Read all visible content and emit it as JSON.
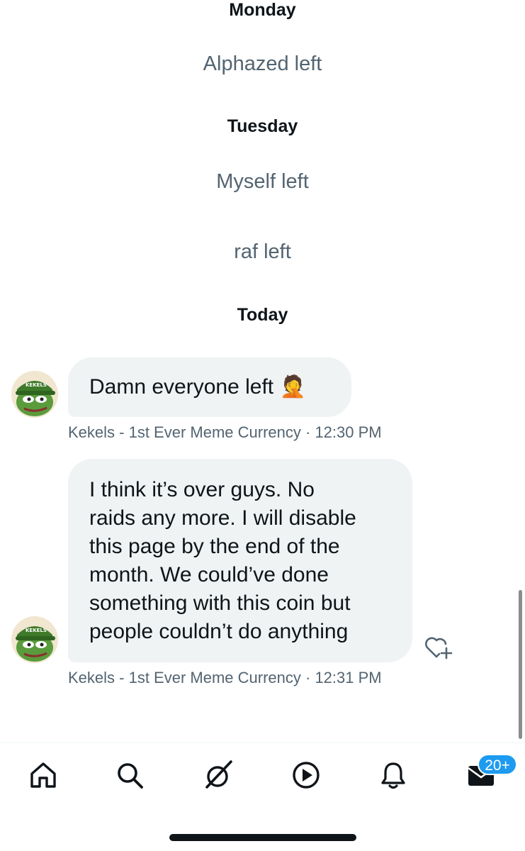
{
  "timeline": [
    {
      "type": "day",
      "label": "Monday"
    },
    {
      "type": "system",
      "text": "Alphazed left"
    },
    {
      "type": "day",
      "label": "Tuesday"
    },
    {
      "type": "system",
      "text": "Myself left"
    },
    {
      "type": "system",
      "text": "raf left"
    },
    {
      "type": "day",
      "label": "Today"
    }
  ],
  "messages": [
    {
      "lines": [
        "Damn everyone left"
      ],
      "emoji": "🤦",
      "sender": "Kekels - 1st Ever Meme Currency",
      "time": "12:30 PM",
      "avatar_text": "KEKELS"
    },
    {
      "lines": [
        "I think it’s over guys. No",
        "raids any more. I will disable",
        "this page by the end of the",
        "month. We could’ve done",
        "something with this coin but",
        "people couldn’t do anything"
      ],
      "sender": "Kekels - 1st Ever Meme Currency",
      "time": "12:31 PM",
      "avatar_text": "KEKELS"
    }
  ],
  "meta_separator": " · ",
  "tabbar": {
    "items": [
      "home-icon",
      "search-icon",
      "grok-icon",
      "video-icon",
      "notifications-icon",
      "messages-icon"
    ],
    "messages_badge": "20+"
  },
  "colors": {
    "accent": "#1d9bf0",
    "bubble": "#eff3f4",
    "secondary_text": "#536471"
  }
}
